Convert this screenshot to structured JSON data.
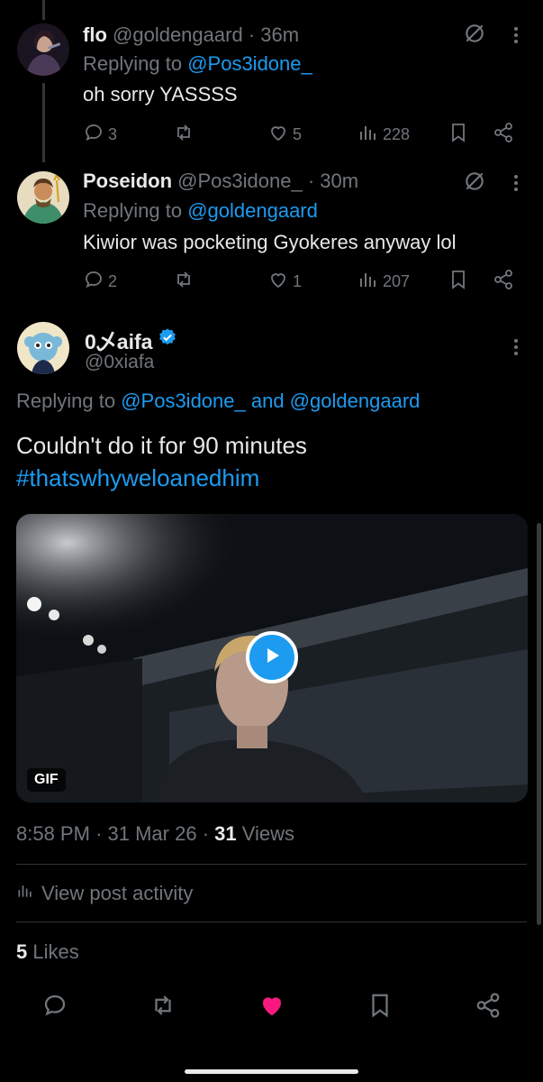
{
  "replies": [
    {
      "name": "flo",
      "handle": "@goldengaard",
      "time": "· 36m",
      "replying_prefix": "Replying to",
      "replying_to": "@Pos3idone_",
      "text": "oh sorry YASSSS",
      "replies_count": "3",
      "retweets_count": "",
      "likes_count": "5",
      "views_count": "228"
    },
    {
      "name": "Poseidon",
      "handle": "@Pos3idone_",
      "time": "· 30m",
      "replying_prefix": "Replying to",
      "replying_to": "@goldengaard",
      "text": "Kiwior was pocketing Gyokeres anyway lol",
      "replies_count": "2",
      "retweets_count": "",
      "likes_count": "1",
      "views_count": "207"
    }
  ],
  "main": {
    "name": "0乄aifa",
    "handle": "@0xiafa",
    "replying_prefix": "Replying to",
    "replying_to_1": "@Pos3idone_",
    "replying_and": "and",
    "replying_to_2": "@goldengaard",
    "text_line1": "Couldn't do it for 90 minutes",
    "hashtag": "#thatswhyweloanedhim",
    "media_badge": "GIF",
    "time": "8:58 PM",
    "date": "31 Mar 26",
    "views_count": "31",
    "views_label": "Views",
    "activity_label": "View post activity",
    "likes_count": "5",
    "likes_label": "Likes"
  },
  "colors": {
    "background": "#000000",
    "accent": "#1d9bf0",
    "muted": "#71767b",
    "like_active": "#f91880"
  },
  "icons": [
    "reply-icon",
    "retweet-icon",
    "like-icon",
    "views-icon",
    "bookmark-icon",
    "share-icon",
    "grok-icon",
    "more-icon",
    "verified-icon",
    "play-icon"
  ]
}
